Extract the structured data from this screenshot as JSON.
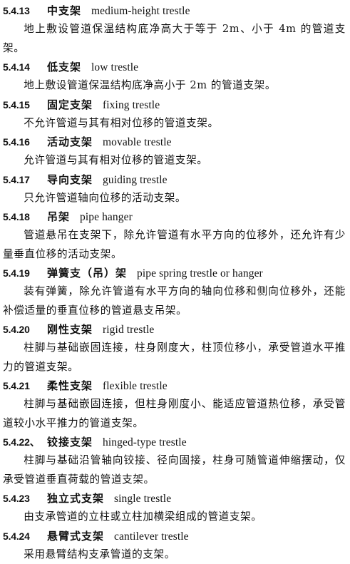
{
  "entries": [
    {
      "num": "5.4.13",
      "zh": "中支架",
      "en": "medium-height trestle",
      "def": "地上敷设管道保温结构底净高大于等于 2m、小于 4m 的管道支架。"
    },
    {
      "num": "5.4.14",
      "zh": "低支架",
      "en": "low trestle",
      "def": "地上敷设管道保温结构底净高小于 2m 的管道支架。"
    },
    {
      "num": "5.4.15",
      "zh": "固定支架",
      "en": "fixing trestle",
      "def": "不允许管道与其有相对位移的管道支架。"
    },
    {
      "num": "5.4.16",
      "zh": "活动支架",
      "en": "movable trestle",
      "def": "允许管道与其有相对位移的管道支架。"
    },
    {
      "num": "5.4.17",
      "zh": "导向支架",
      "en": "guiding trestle",
      "def": "只允许管道轴向位移的活动支架。"
    },
    {
      "num": "5.4.18",
      "zh": "吊架",
      "en": "pipe hanger",
      "def": "管道悬吊在支架下，除允许管道有水平方向的位移外，还允许有少量垂直位移的活动支架。"
    },
    {
      "num": "5.4.19",
      "zh": "弹簧支（吊）架",
      "en": "pipe spring trestle or hanger",
      "def": "装有弹簧，除允许管道有水平方向的轴向位移和侧向位移外，还能补偿适量的垂直位移的管道悬支吊架。"
    },
    {
      "num": "5.4.20",
      "zh": "刚性支架",
      "en": "rigid trestle",
      "def": "柱脚与基础嵌固连接，柱身刚度大，柱顶位移小，承受管道水平推力的管道支架。"
    },
    {
      "num": "5.4.21",
      "zh": "柔性支架",
      "en": "flexible trestle",
      "def": "柱脚与基础嵌固连接，但柱身刚度小、能适应管道热位移，承受管道较小水平推力的管道支架。"
    },
    {
      "num": "5.4.22、",
      "zh": "铰接支架",
      "en": "hinged-type trestle",
      "def": "柱脚与基础沿管轴向铰接、径向固接，柱身可随管道伸缩摆动，仅承受管道垂直荷载的管道支架。"
    },
    {
      "num": "5.4.23",
      "zh": "独立式支架",
      "en": "single trestle",
      "def": "由支承管道的立柱或立柱加横梁组成的管道支架。"
    },
    {
      "num": "5.4.24",
      "zh": "悬臂式支架",
      "en": "cantilever trestle",
      "def": "采用悬臂结构支承管道的支架。"
    }
  ]
}
